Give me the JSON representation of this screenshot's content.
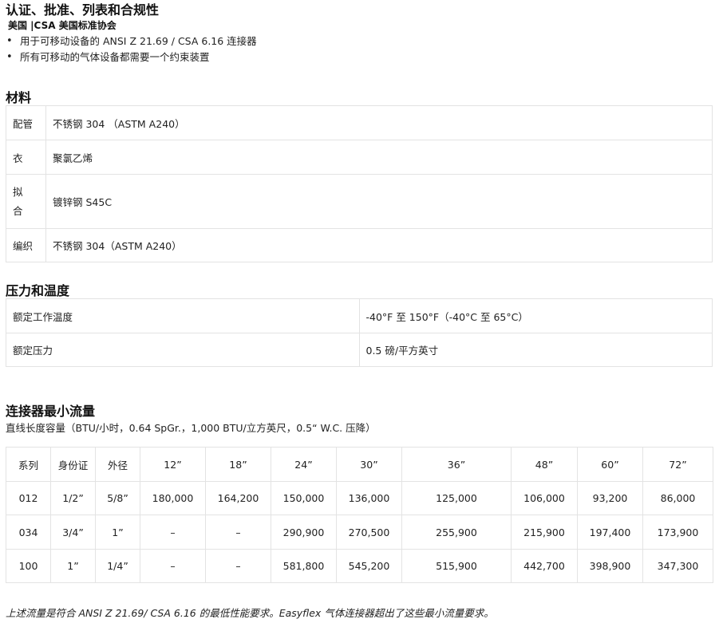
{
  "certs": {
    "title": "认证、批准、列表和合规性",
    "subtitle": "美国 |CSA 美国标准协会",
    "items": [
      "用于可移动设备的 ANSI Z 21.69 / CSA 6.16 连接器",
      "所有可移动的气体设备都需要一个约束装置"
    ]
  },
  "materials": {
    "title": "材料",
    "rows": [
      {
        "key": "配管",
        "value": "不锈钢 304 （ASTM A240）"
      },
      {
        "key": "衣",
        "value": "聚氯乙烯"
      },
      {
        "key_lines": [
          "拟",
          "合"
        ],
        "value": "镀锌钢 S45C"
      },
      {
        "key": "编织",
        "value": "不锈钢 304（ASTM A240）"
      }
    ]
  },
  "pressure": {
    "title": "压力和温度",
    "rows": [
      {
        "key": "额定工作温度",
        "value": "-40°F 至 150°F（-40°C 至 65°C）"
      },
      {
        "key": "额定压力",
        "value": "0.5 磅/平方英寸"
      }
    ]
  },
  "flow": {
    "title": "连接器最小流量",
    "description": "直线长度容量（BTU/小时，0.64 SpGr.，1,000 BTU/立方英尺，0.5“ W.C. 压降）",
    "headers": [
      "系列",
      "身份证",
      "外径",
      "12”",
      "18”",
      "24”",
      "30”",
      "36”",
      "48”",
      "60”",
      "72”"
    ],
    "rows": [
      [
        "012",
        "1/2”",
        "5/8”",
        "180,000",
        "164,200",
        "150,000",
        "136,000",
        "125,000",
        "106,000",
        "93,200",
        "86,000"
      ],
      [
        "034",
        "3/4”",
        "1”",
        "–",
        "–",
        "290,900",
        "270,500",
        "255,900",
        "215,900",
        "197,400",
        "173,900"
      ],
      [
        "100",
        "1”",
        "1/4”",
        "–",
        "–",
        "581,800",
        "545,200",
        "515,900",
        "442,700",
        "398,900",
        "347,300"
      ]
    ],
    "note": "上述流量是符合 ANSI Z 21.69/ CSA 6.16 的最低性能要求。Easyflex 气体连接器超出了这些最小流量要求。"
  }
}
